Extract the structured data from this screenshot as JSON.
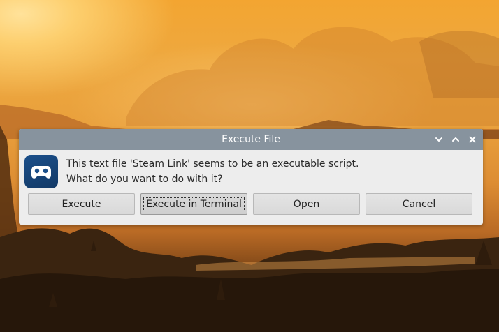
{
  "dialog": {
    "title": "Execute File",
    "message_line1": "This text file 'Steam Link' seems to be an executable script.",
    "message_line2": "What do you want to do with it?",
    "icon": "steam-link-gamepad-icon",
    "titlebar_controls": [
      "chevron-down-icon",
      "chevron-up-icon",
      "close-icon"
    ],
    "buttons": {
      "execute": "Execute",
      "execute_in_terminal": "Execute in Terminal",
      "open": "Open",
      "cancel": "Cancel"
    },
    "focused_button": "execute_in_terminal"
  },
  "colors": {
    "titlebar": "#87939e",
    "dialog_bg": "#ededed",
    "icon_bg": "#1b4f8a"
  }
}
